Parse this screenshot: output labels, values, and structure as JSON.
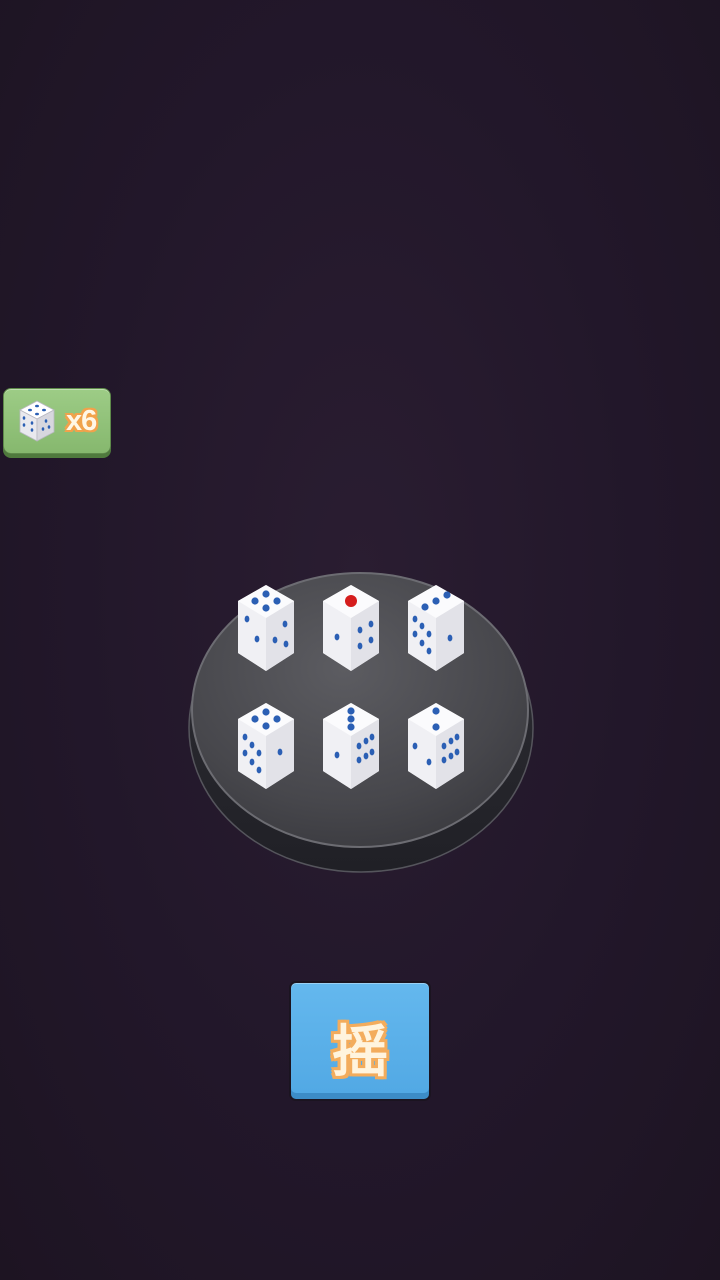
{
  "badge": {
    "count_label": "x6",
    "icon": "dice-icon"
  },
  "plate": {
    "dice": [
      {
        "top_face": 4,
        "colors": {
          "pip": "#2b5fb4"
        }
      },
      {
        "top_face": 1,
        "colors": {
          "pip": "#d51d1d"
        }
      },
      {
        "top_face": 3,
        "colors": {
          "pip": "#2b5fb4"
        }
      },
      {
        "top_face": 4,
        "colors": {
          "pip": "#2b5fb4"
        }
      },
      {
        "top_face": 3,
        "colors": {
          "pip": "#2b5fb4"
        }
      },
      {
        "top_face": 2,
        "colors": {
          "pip": "#2b5fb4"
        }
      }
    ]
  },
  "shake_button": {
    "label": "摇"
  },
  "colors": {
    "background": "#22172a",
    "badge_green": "#8fbf76",
    "button_blue": "#5bb0ea",
    "label_orange": "#f3ac5c",
    "plate_gray": "#4a4a4e"
  }
}
